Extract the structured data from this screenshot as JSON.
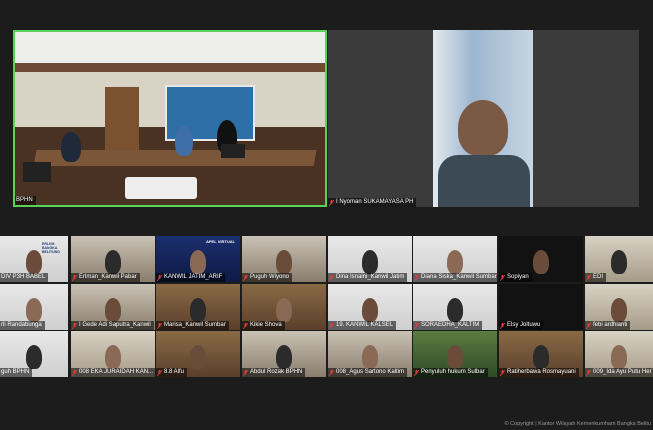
{
  "featured": {
    "conference_room_label": "BPHN",
    "remote_speaker_label": "I Nyoman SUKAMAYASA PH"
  },
  "gallery": [
    {
      "label": "DIV P3H BABEL",
      "muted": false
    },
    {
      "label": "Erlman_Kanwil Pabar",
      "muted": true
    },
    {
      "label": "KANWIL JATIM_ARIF",
      "muted": true
    },
    {
      "label": "Puguh Wiyono",
      "muted": true
    },
    {
      "label": "Dina Isnaini_Kanwil Jatim",
      "muted": true
    },
    {
      "label": "Diana Siska_Kanwil Sumbar",
      "muted": true
    },
    {
      "label": "Sopiyan",
      "muted": true
    },
    {
      "label": "EDI",
      "muted": true
    },
    {
      "label": "rli Randabunga",
      "muted": false
    },
    {
      "label": "I Gede Adi Saputra_Kanwil",
      "muted": true
    },
    {
      "label": "Marisa_Kanwil Sumbar",
      "muted": true
    },
    {
      "label": "Kikie Shova",
      "muted": true
    },
    {
      "label": "19. KANWIL KALSEL",
      "muted": true
    },
    {
      "label": "SORAEDHA_KALTIM",
      "muted": true
    },
    {
      "label": "Elsy Joltuwu",
      "muted": true
    },
    {
      "label": "febi ardhianti",
      "muted": true
    },
    {
      "label": "guh BPHN",
      "muted": false
    },
    {
      "label": "008 EKA JURAIDAH KAN...",
      "muted": true
    },
    {
      "label": "8.8 Alfu",
      "muted": true
    },
    {
      "label": "Abdul Rozak BPHN",
      "muted": true
    },
    {
      "label": "008_Agus Sartono Kaltim",
      "muted": true
    },
    {
      "label": "Penyuluh hukum Sulbar",
      "muted": true
    },
    {
      "label": "Ratiherbawa Rosmayuani",
      "muted": true
    },
    {
      "label": "009_Ida Ayu Putu Her",
      "muted": true
    }
  ],
  "tile_content": {
    "babel_sign": "ERLKM BANGKA BELITUNG",
    "jatim_banner": "APEL VIRTUAL"
  },
  "footer": "© Copyright | Kantor Wilayah Kemenkumham Bangka Belitu",
  "colors": {
    "active_speaker_border": "#5bd35b",
    "muted_icon": "#e23b3b",
    "background": "#1c1c1c"
  }
}
